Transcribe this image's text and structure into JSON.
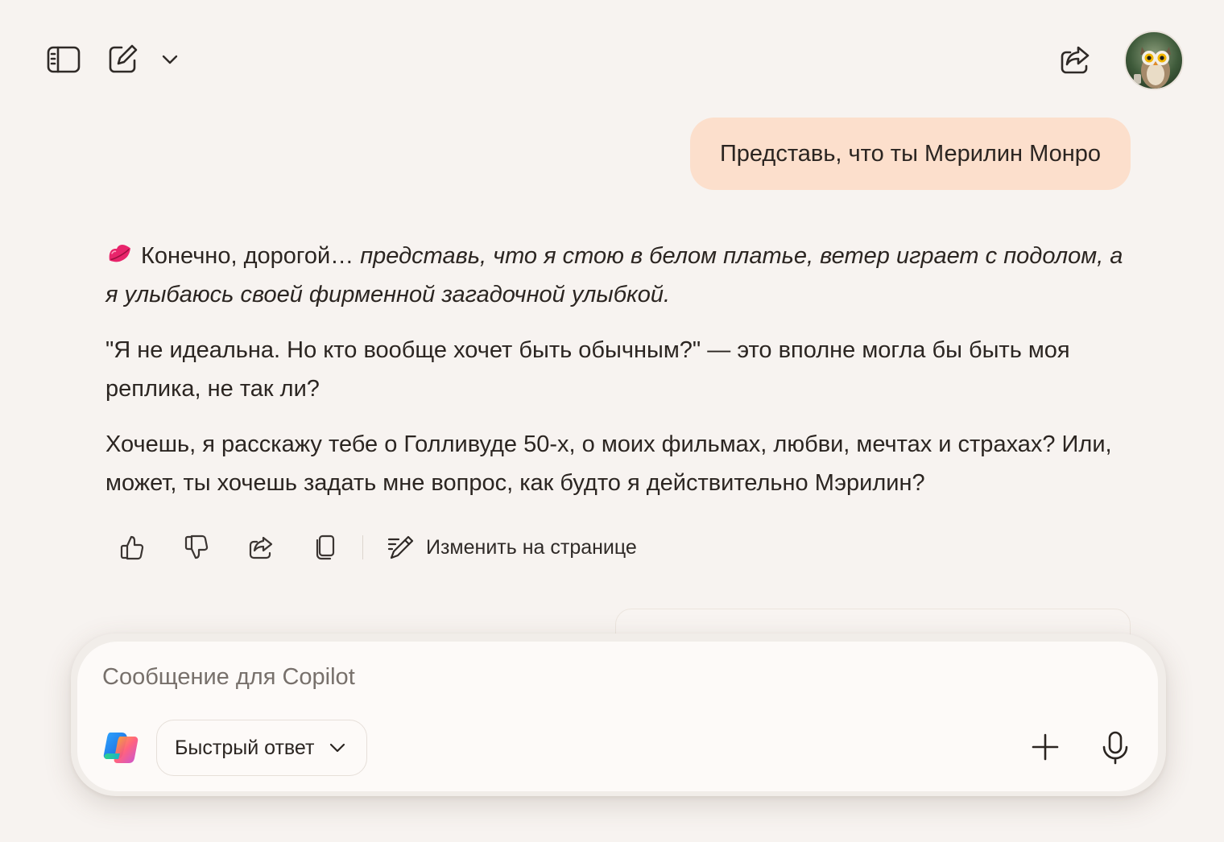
{
  "header": {
    "icons": [
      "sidebar-toggle-icon",
      "new-chat-icon",
      "chevron-down-icon",
      "share-icon",
      "avatar"
    ]
  },
  "conversation": {
    "user_message": "Представь, что ты Мерилин Монро",
    "reply": {
      "emoji": "kiss-mark-icon",
      "p1_normal": "Конечно, дорогой… ",
      "p1_italic": "представь, что я стою в белом платье, ветер играет с подолом, а я улыбаюсь своей фирменной загадочной улыбкой.",
      "p2": "\"Я не идеальна. Но кто вообще хочет быть обычным?\" — это вполне могла бы быть моя реплика, не так ли?",
      "p3": "Хочешь, я расскажу тебе о Голливуде 50-х, о моих фильмах, любви, мечтах и страхах? Или, может, ты хочешь задать мне вопрос, как будто я действительно Мэрилин?"
    },
    "actions": {
      "icons": [
        "thumbs-up-icon",
        "thumbs-down-icon",
        "share-icon",
        "copy-icon",
        "edit-page-icon"
      ],
      "edit_label": "Изменить на странице"
    }
  },
  "composer": {
    "placeholder": "Сообщение для Copilot",
    "mode_label": "Быстрый ответ",
    "icons": [
      "copilot-logo-icon",
      "plus-icon",
      "microphone-icon"
    ]
  },
  "colors": {
    "background": "#f7f3f0",
    "user_bubble": "#fcdfcc",
    "composer": "#fdfaf8",
    "text": "#2b2521"
  }
}
